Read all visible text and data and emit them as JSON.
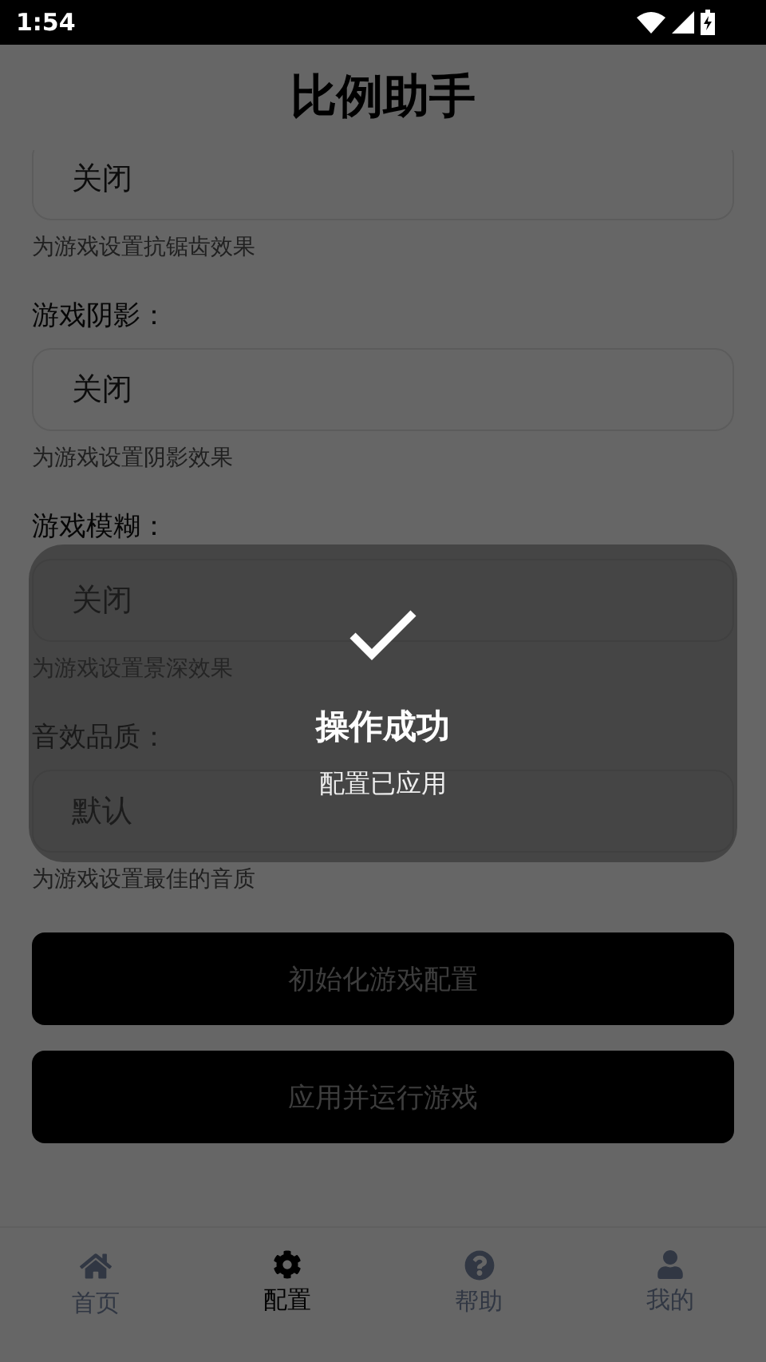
{
  "status_bar": {
    "time": "1:54"
  },
  "header": {
    "title": "比例助手"
  },
  "settings": [
    {
      "value": "关闭",
      "hint": "为游戏设置抗锯齿效果"
    },
    {
      "label": "游戏阴影：",
      "value": "关闭",
      "hint": "为游戏设置阴影效果"
    },
    {
      "label": "游戏模糊：",
      "value": "关闭",
      "hint": "为游戏设置景深效果"
    },
    {
      "label": "音效品质：",
      "value": "默认",
      "hint": "为游戏设置最佳的音质"
    }
  ],
  "buttons": [
    "初始化游戏配置",
    "应用并运行游戏"
  ],
  "toast": {
    "title": "操作成功",
    "message": "配置已应用"
  },
  "bottom_nav": [
    {
      "kind": "home",
      "label": "首页",
      "selected": false
    },
    {
      "kind": "settings",
      "label": "配置",
      "selected": true
    },
    {
      "kind": "help",
      "label": "帮助",
      "selected": false
    },
    {
      "kind": "profile",
      "label": "我的",
      "selected": false
    }
  ]
}
